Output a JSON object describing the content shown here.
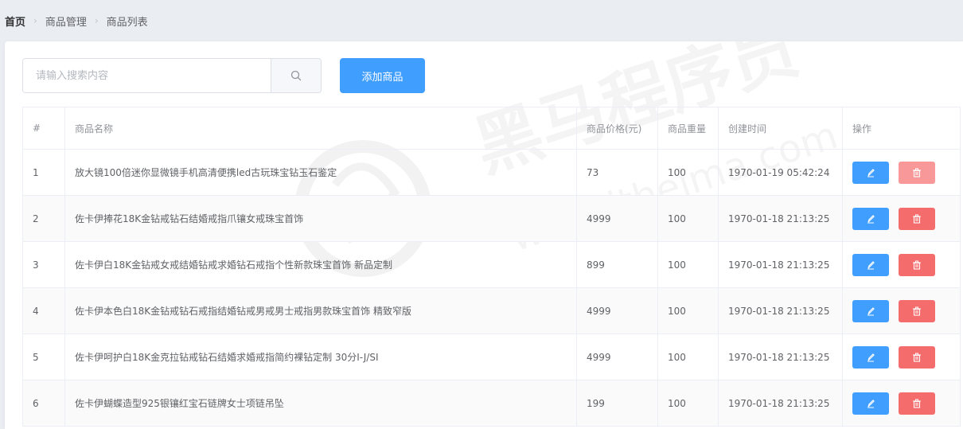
{
  "breadcrumb": {
    "items": [
      "首页",
      "商品管理",
      "商品列表"
    ]
  },
  "search": {
    "placeholder": "请输入搜索内容"
  },
  "toolbar": {
    "add_label": "添加商品"
  },
  "watermark": {
    "text1": "黑马程序员",
    "text2": "www.itheima.com"
  },
  "table": {
    "headers": [
      "#",
      "商品名称",
      "商品价格(元)",
      "商品重量",
      "创建时间",
      "操作"
    ],
    "rows": [
      {
        "index": "1",
        "name": "放大镜100倍迷你显微镜手机高清便携led古玩珠宝钻玉石鉴定",
        "price": "73",
        "weight": "100",
        "time": "1970-01-19 05:42:24"
      },
      {
        "index": "2",
        "name": "佐卡伊捧花18K金钻戒钻石结婚戒指爪镶女戒珠宝首饰",
        "price": "4999",
        "weight": "100",
        "time": "1970-01-18 21:13:25"
      },
      {
        "index": "3",
        "name": "佐卡伊白18K金钻戒女戒结婚钻戒求婚钻石戒指个性新款珠宝首饰 新品定制",
        "price": "899",
        "weight": "100",
        "time": "1970-01-18 21:13:25"
      },
      {
        "index": "4",
        "name": "佐卡伊本色白18K金钻戒钻石戒指结婚钻戒男戒男士戒指男款珠宝首饰 精致窄版",
        "price": "4999",
        "weight": "100",
        "time": "1970-01-18 21:13:25"
      },
      {
        "index": "5",
        "name": "佐卡伊呵护白18K金克拉钻戒钻石结婚求婚戒指简约裸钻定制 30分I-J/SI",
        "price": "4999",
        "weight": "100",
        "time": "1970-01-18 21:13:25"
      },
      {
        "index": "6",
        "name": "佐卡伊蝴蝶造型925银镶红宝石链牌女士项链吊坠",
        "price": "199",
        "weight": "100",
        "time": "1970-01-18 21:13:25"
      }
    ]
  },
  "colors": {
    "primary": "#409eff",
    "danger": "#f56c6c",
    "danger_light": "#f89898",
    "background": "#eaedf1"
  }
}
